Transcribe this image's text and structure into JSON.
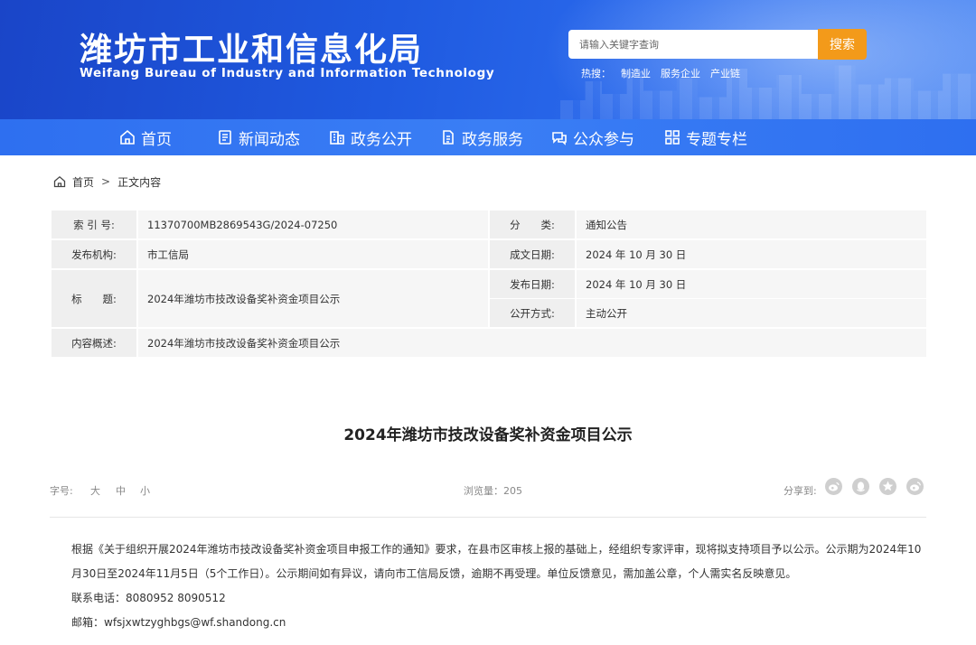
{
  "header": {
    "title": "潍坊市工业和信息化局",
    "subtitle": "Weifang Bureau of Industry and Information Technology",
    "search_placeholder": "请输入关键字查询",
    "search_button": "搜索",
    "hotwords_label": "热搜：",
    "hotwords": [
      "制造业",
      "服务企业",
      "产业链"
    ]
  },
  "nav": {
    "items": [
      {
        "label": "首页",
        "icon": "home-icon"
      },
      {
        "label": "新闻动态",
        "icon": "news-icon"
      },
      {
        "label": "政务公开",
        "icon": "building-icon"
      },
      {
        "label": "政务服务",
        "icon": "document-icon"
      },
      {
        "label": "公众参与",
        "icon": "chat-icon"
      },
      {
        "label": "专题专栏",
        "icon": "grid-icon"
      }
    ]
  },
  "breadcrumb": {
    "home": "首页",
    "separator": ">",
    "current": "正文内容"
  },
  "info": {
    "index_label": "索 引 号:",
    "index_value": "11370700MB2869543G/2024-07250",
    "category_label": "分　　类:",
    "category_value": "通知公告",
    "publisher_label": "发布机构:",
    "publisher_value": "市工信局",
    "created_label": "成文日期:",
    "created_value": "2024 年 10 月 30 日",
    "title_label": "标　　题:",
    "title_value": "2024年潍坊市技改设备奖补资金项目公示",
    "published_label": "发布日期:",
    "published_value": "2024 年 10 月 30 日",
    "disclosure_label": "公开方式:",
    "disclosure_value": "主动公开",
    "summary_label": "内容概述:",
    "summary_value": "2024年潍坊市技改设备奖补资金项目公示"
  },
  "article": {
    "title": "2024年潍坊市技改设备奖补资金项目公示",
    "font_size_label": "字号:",
    "font_sizes": [
      "大",
      "中",
      "小"
    ],
    "views": "浏览量：205",
    "share_label": "分享到:",
    "paragraph1": "根据《关于组织开展2024年潍坊市技改设备奖补资金项目申报工作的通知》要求，在县市区审核上报的基础上，经组织专家评审，现将拟支持项目予以公示。公示期为2024年10月30日至2024年11月5日（5个工作日）。公示期间如有异议，请向市工信局反馈，逾期不再受理。单位反馈意见，需加盖公章，个人需实名反映意见。",
    "phone": "联系电话：8080952  8090512",
    "email": "邮箱：wfsjxwtzyghbgs@wf.shandong.cn"
  },
  "colors": {
    "banner": "#1f5ae0",
    "nav": "#3a7ef5",
    "search_button": "#f39a1a"
  }
}
